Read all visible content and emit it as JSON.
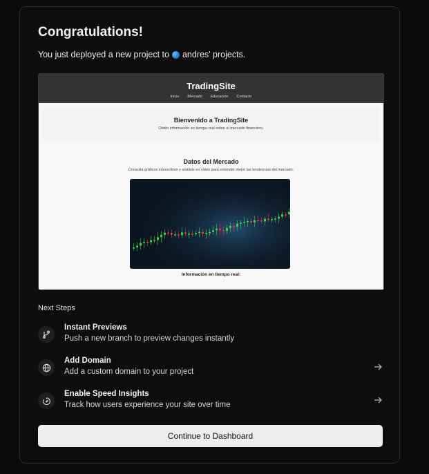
{
  "card": {
    "title": "Congratulations!",
    "subtitle_prefix": "You just deployed a new project to",
    "team_name": "andres' projects."
  },
  "preview": {
    "site_title": "TradingSite",
    "nav": [
      "Inicio",
      "Mercado",
      "Educación",
      "Contacto"
    ],
    "hero_title": "Bienvenido a TradingSite",
    "hero_text": "Obtén información en tiempo real sobre el mercado financiero.",
    "section_title": "Datos del Mercado",
    "section_text": "Consulta gráficos interactivos y análisis en video para entender mejor las tendencias del mercado.",
    "realtime_label": "Información en tiempo real:"
  },
  "next_steps": {
    "heading": "Next Steps",
    "items": [
      {
        "title": "Instant Previews",
        "description": "Push a new branch to preview changes instantly",
        "icon": "git-branch-icon"
      },
      {
        "title": "Add Domain",
        "description": "Add a custom domain to your project",
        "icon": "globe-icon"
      },
      {
        "title": "Enable Speed Insights",
        "description": "Track how users experience your site over time",
        "icon": "speed-gauge-icon"
      }
    ]
  },
  "continue_label": "Continue to Dashboard"
}
